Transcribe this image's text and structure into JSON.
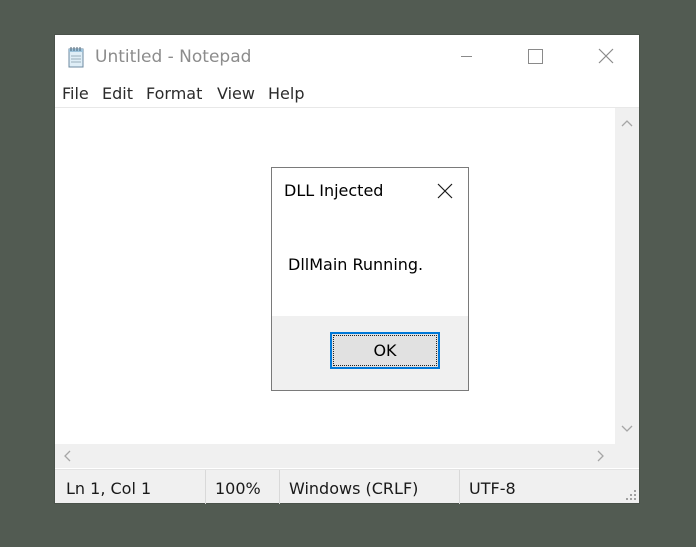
{
  "window": {
    "title": "Untitled - Notepad",
    "app_icon": "notepad-icon",
    "controls": [
      "minimize-icon",
      "maximize-icon",
      "close-icon"
    ]
  },
  "menu": {
    "items": [
      "File",
      "Edit",
      "Format",
      "View",
      "Help"
    ]
  },
  "editor": {
    "content": ""
  },
  "statusbar": {
    "position": "Ln 1, Col 1",
    "zoom": "100%",
    "line_ending": "Windows (CRLF)",
    "encoding": "UTF-8"
  },
  "dialog": {
    "title": "DLL Injected",
    "message": "DllMain Running.",
    "ok_label": "OK",
    "close_icon": "close-icon"
  },
  "colors": {
    "desktop": "#525b52",
    "focus_accent": "#0078d7",
    "title_inactive": "#8c8c8c",
    "chrome_gray": "#f0f0f0"
  }
}
